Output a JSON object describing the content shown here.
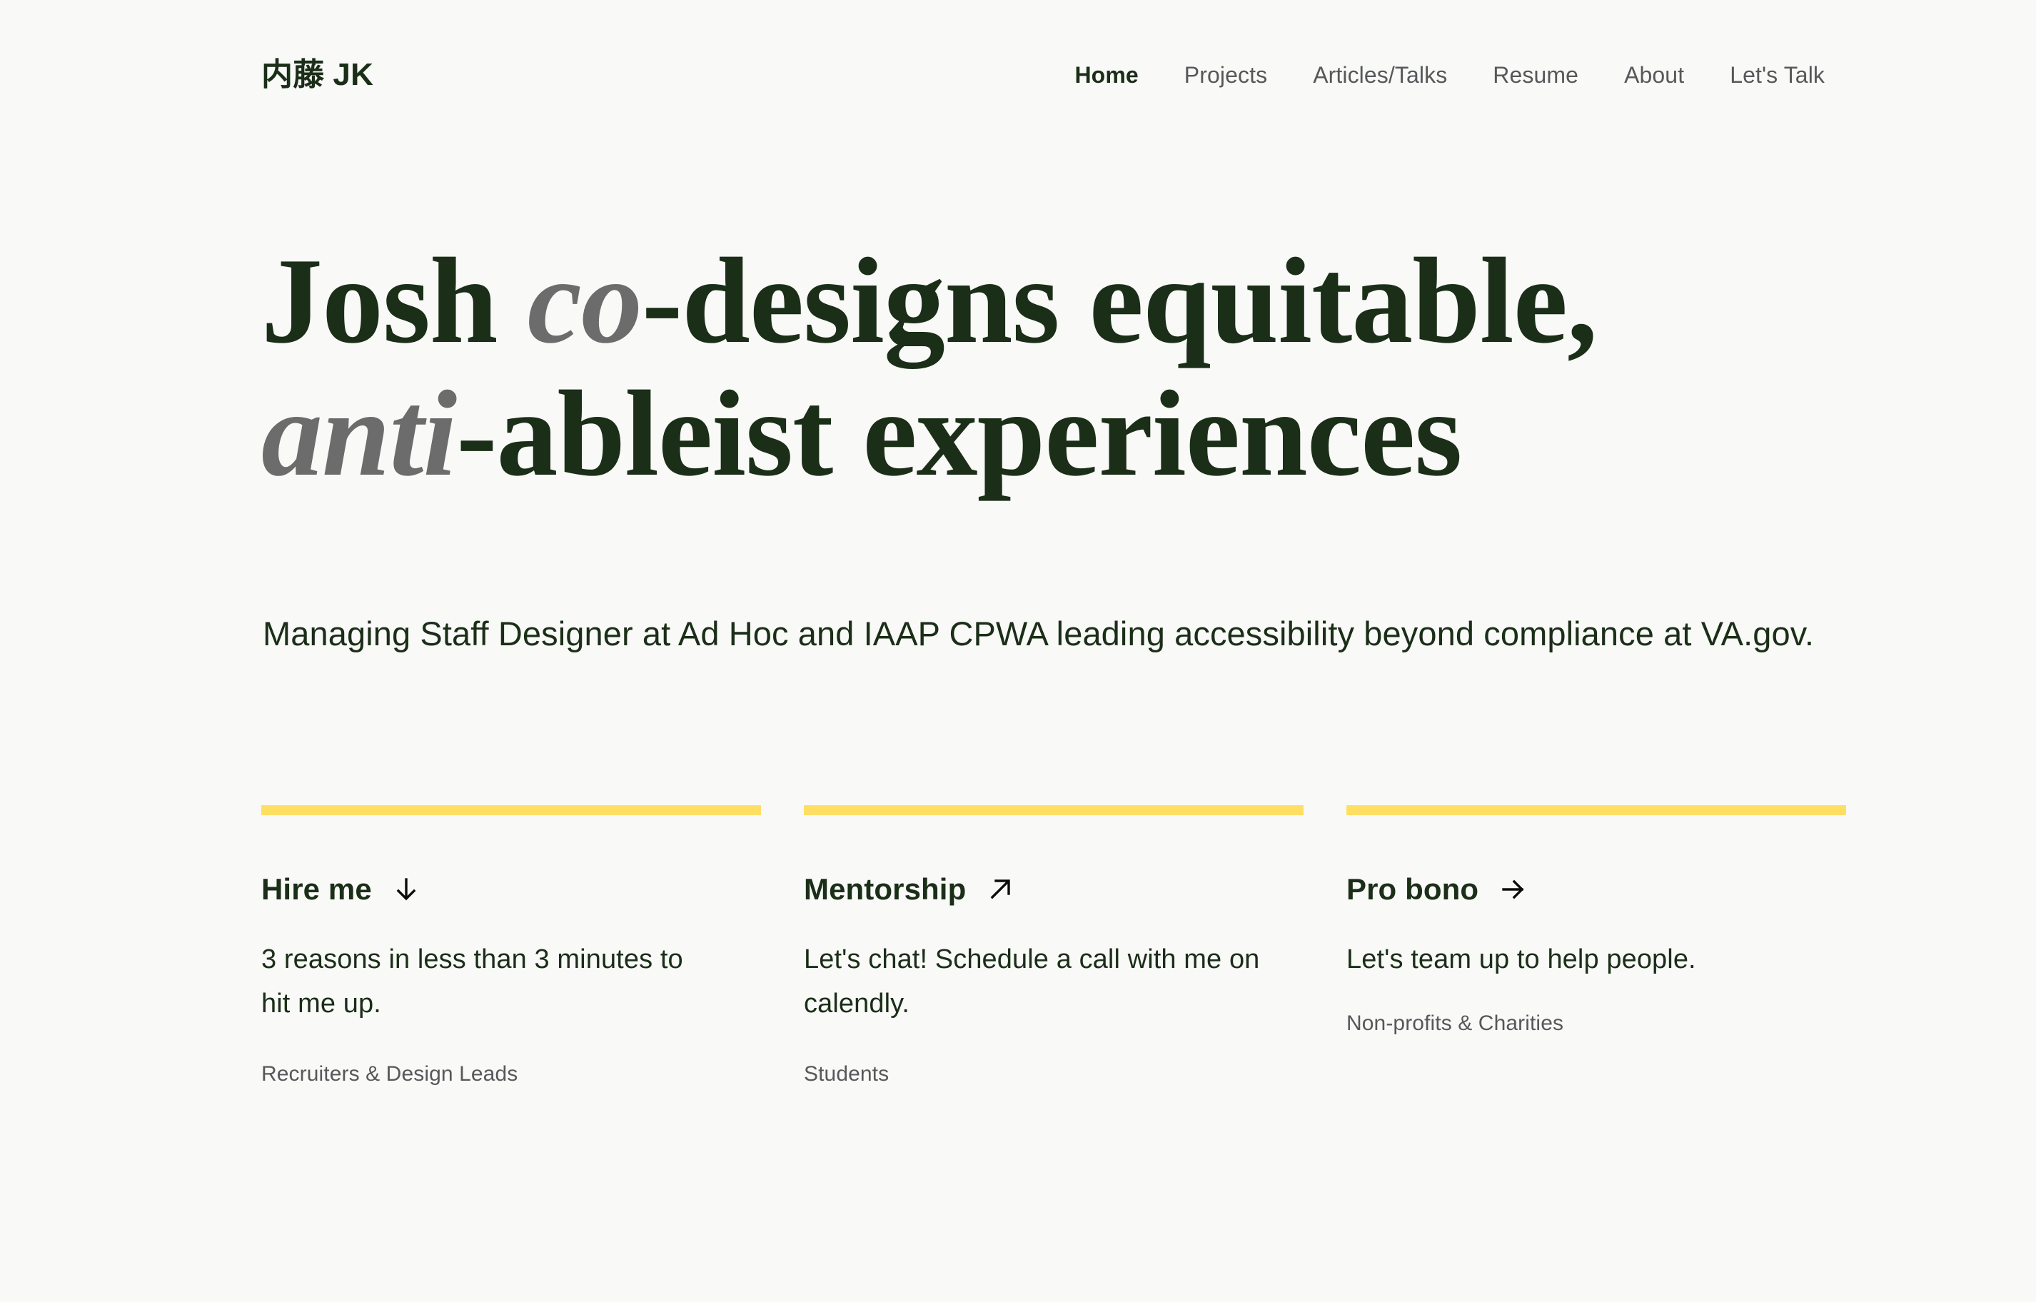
{
  "site": {
    "background_color": "#f9f9f8",
    "primary_color": "#1b2e18",
    "muted_color": "#56585a",
    "accent_color": "#ffdf63"
  },
  "header": {
    "brand": {
      "kanji": "内藤",
      "initials": "JK",
      "full": "内藤 JK"
    },
    "nav": [
      {
        "label": "Home",
        "active": true
      },
      {
        "label": "Projects",
        "active": false
      },
      {
        "label": "Articles/Talks",
        "active": false
      },
      {
        "label": "Resume",
        "active": false
      },
      {
        "label": "About",
        "active": false
      },
      {
        "label": "Let's Talk",
        "active": false
      }
    ]
  },
  "hero": {
    "title_line1_part1": "Josh ",
    "title_line1_accent": "co",
    "title_line1_part2": "-designs equitable,",
    "title_line2_accent": "anti",
    "title_line2_part2": "-ableist experiences",
    "subtitle": "Managing Staff Designer at Ad Hoc and IAAP CPWA leading accessibility beyond compliance at VA.gov."
  },
  "cards": [
    {
      "title": "Hire me",
      "arrow_icon": "arrow-down-icon",
      "body": "3 reasons in less than 3 minutes to hit me up.",
      "audience": "Recruiters & Design Leads"
    },
    {
      "title": "Mentorship",
      "arrow_icon": "arrow-up-right-icon",
      "body": "Let's chat! Schedule a call with me on calendly.",
      "audience": "Students"
    },
    {
      "title": "Pro bono",
      "arrow_icon": "arrow-right-icon",
      "body": "Let's team up to help people.",
      "audience": "Non-profits & Charities"
    }
  ]
}
